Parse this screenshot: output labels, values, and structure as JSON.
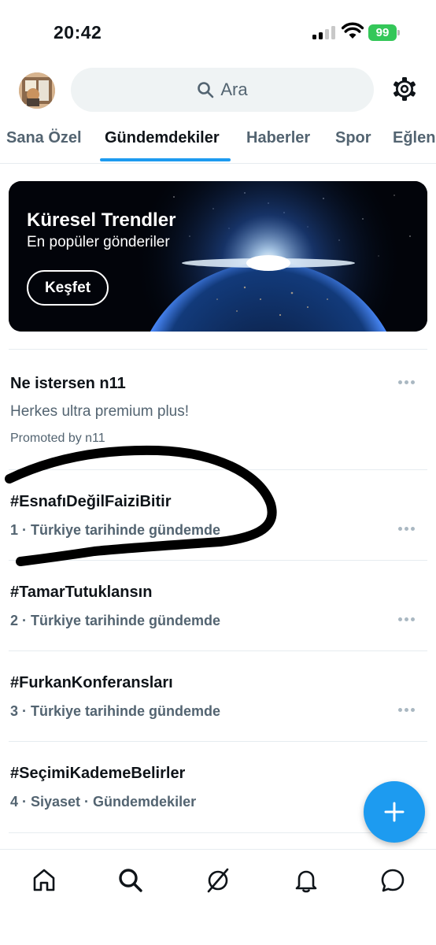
{
  "status_bar": {
    "time": "20:42",
    "battery": "99"
  },
  "header": {
    "search_placeholder": "Ara",
    "icons": [
      "avatar",
      "search-icon",
      "gear-icon"
    ]
  },
  "tabs": [
    {
      "label": "Sana Özel",
      "active": false
    },
    {
      "label": "Gündemdekiler",
      "active": true
    },
    {
      "label": "Haberler",
      "active": false
    },
    {
      "label": "Spor",
      "active": false
    },
    {
      "label": "Eğlen",
      "active": false
    }
  ],
  "banner": {
    "title": "Küresel Trendler",
    "subtitle": "En popüler gönderiler",
    "button_label": "Keşfet"
  },
  "promoted": {
    "title": "Ne istersen n11",
    "text": "Herkes ultra premium plus!",
    "by": "Promoted by n11"
  },
  "trends": [
    {
      "title": "#EsnafıDeğilFaiziBitir",
      "meta": "1 · Türkiye tarihinde gündemde"
    },
    {
      "title": "#TamarTutuklansın",
      "meta": "2 · Türkiye tarihinde gündemde"
    },
    {
      "title": "#FurkanKonferansları",
      "meta": "3 · Türkiye tarihinde gündemde"
    },
    {
      "title": "#SeçimiKademeBelirler",
      "meta": "4 · Siyaset · Gündemdekiler"
    }
  ],
  "colors": {
    "accent": "#1d9bf0",
    "text": "#0f1419",
    "muted": "#536471",
    "battery": "#34c759"
  },
  "bottom_nav": [
    "home-icon",
    "search-icon",
    "grok-icon",
    "notifications-icon",
    "messages-icon"
  ]
}
